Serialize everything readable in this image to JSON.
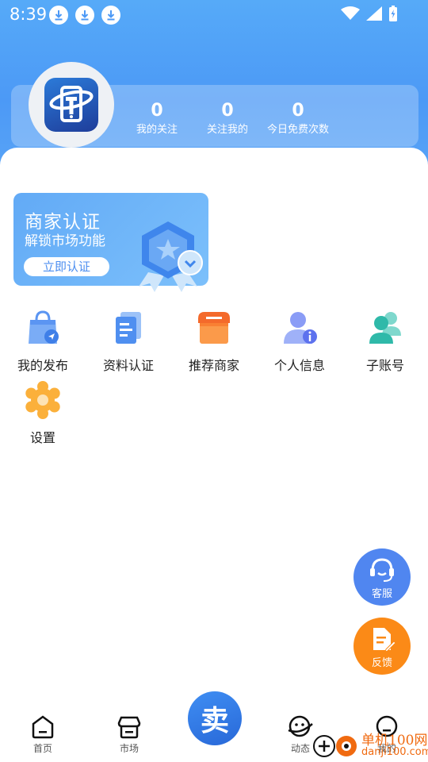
{
  "status_bar": {
    "time": "8:39",
    "download_icons": [
      "download-icon",
      "download-icon",
      "download-icon"
    ],
    "right_icons": [
      "wifi-icon",
      "signal-icon",
      "battery-charging-icon"
    ]
  },
  "profile": {
    "avatar_icon": "app-logo-phone-icon",
    "stats": [
      {
        "value": "0",
        "label": "我的关注"
      },
      {
        "value": "0",
        "label": "关注我的"
      },
      {
        "value": "0",
        "label": "今日免费次数"
      }
    ]
  },
  "banner": {
    "title": "商家认证",
    "subtitle": "解锁市场功能",
    "button": "立即认证",
    "badge_icon": "certification-badge-icon"
  },
  "grid": [
    {
      "label": "我的发布",
      "icon": "shopping-bag-send-icon"
    },
    {
      "label": "资料认证",
      "icon": "documents-icon"
    },
    {
      "label": "推荐商家",
      "icon": "storefront-icon"
    },
    {
      "label": "个人信息",
      "icon": "user-info-icon"
    },
    {
      "label": "子账号",
      "icon": "users-icon"
    },
    {
      "label": "设置",
      "icon": "gear-icon"
    }
  ],
  "fabs": {
    "service": {
      "label": "客服",
      "icon": "headset-icon"
    },
    "feedback": {
      "label": "反馈",
      "icon": "edit-document-icon"
    }
  },
  "tabbar": {
    "items": [
      {
        "label": "首页",
        "icon": "home-icon"
      },
      {
        "label": "市场",
        "icon": "market-icon"
      },
      {
        "label": "动态",
        "icon": "chat-planet-icon"
      },
      {
        "label": "我的",
        "icon": "profile-icon"
      }
    ],
    "center": "卖"
  },
  "watermark": {
    "line1": "单机100网",
    "line2": "danji100.com"
  },
  "colors": {
    "primary": "#4c99f6",
    "service_fab": "#5086f0",
    "feedback_fab": "#fb8a17",
    "watermark": "#f06a10"
  }
}
